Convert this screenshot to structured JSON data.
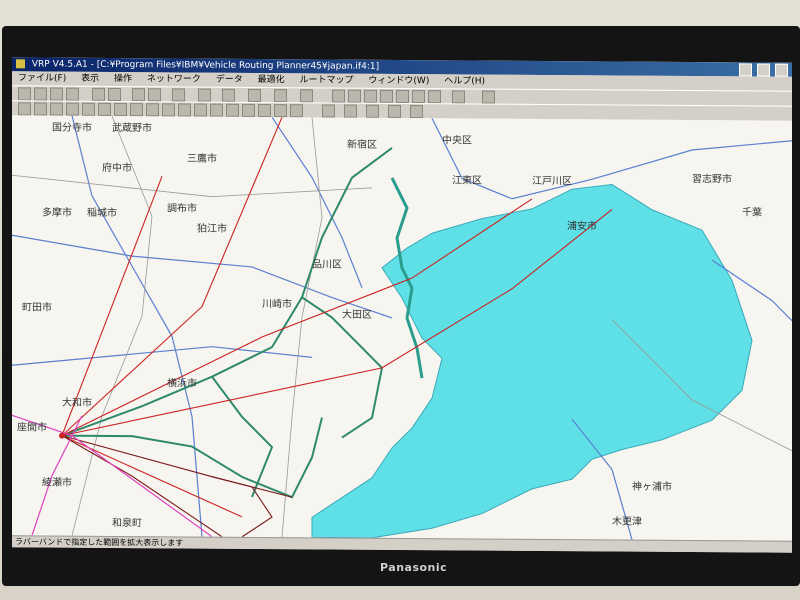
{
  "window": {
    "title": "VRP V4.5.A1 - [C:¥Program Files¥IBM¥Vehicle Routing Planner45¥japan.if4:1]"
  },
  "menu": [
    "ファイル(F)",
    "表示",
    "操作",
    "ネットワーク",
    "データ",
    "最適化",
    "ルートマップ",
    "ウィンドウ(W)",
    "ヘルプ(H)"
  ],
  "map": {
    "places": [
      {
        "name": "国分寺市"
      },
      {
        "name": "武蔵野市"
      },
      {
        "name": "府中市"
      },
      {
        "name": "三鷹市"
      },
      {
        "name": "多摩市"
      },
      {
        "name": "稲城市"
      },
      {
        "name": "調布市"
      },
      {
        "name": "狛江市"
      },
      {
        "name": "新宿区"
      },
      {
        "name": "江東区"
      },
      {
        "name": "江戸川区"
      },
      {
        "name": "浦安市"
      },
      {
        "name": "習志野市"
      },
      {
        "name": "千葉"
      },
      {
        "name": "品川区"
      },
      {
        "name": "大田区"
      },
      {
        "name": "川崎市"
      },
      {
        "name": "町田市"
      },
      {
        "name": "横浜市"
      },
      {
        "name": "座間市"
      },
      {
        "name": "大和市"
      },
      {
        "name": "綾瀬市"
      },
      {
        "name": "和泉町"
      },
      {
        "name": "神ヶ浦市"
      },
      {
        "name": "木更津"
      },
      {
        "name": "中央区"
      }
    ]
  },
  "statusbar": {
    "text": "ラバーバンドで指定した範囲を拡大表示します"
  },
  "tv": {
    "brand": "Panasonic"
  }
}
